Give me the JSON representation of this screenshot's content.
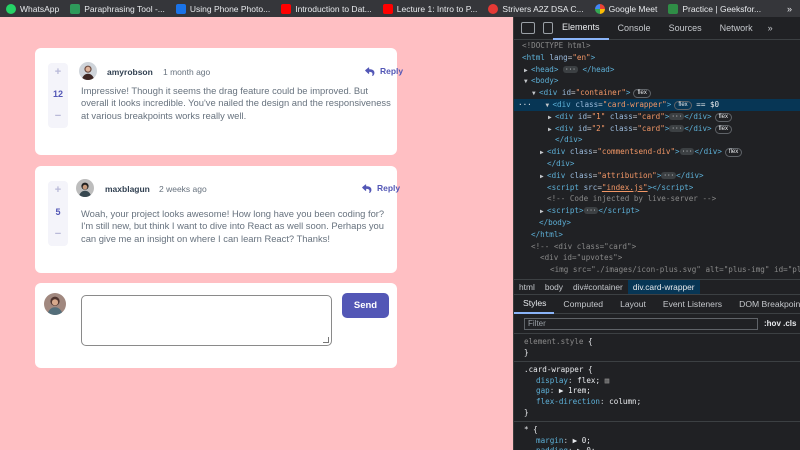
{
  "bookmarks": [
    {
      "label": "WhatsApp",
      "color": "#25d366",
      "icon": "whatsapp-icon"
    },
    {
      "label": "Paraphrasing Tool -...",
      "color": "#2e9a5a",
      "icon": "quillbot-icon"
    },
    {
      "label": "Using Phone Photo...",
      "color": "#1a73e8",
      "icon": "docs-icon"
    },
    {
      "label": "Introduction to Dat...",
      "color": "#ff0000",
      "icon": "youtube-icon"
    },
    {
      "label": "Lecture 1: Intro to P...",
      "color": "#ff0000",
      "icon": "youtube-icon"
    },
    {
      "label": "Strivers A2Z DSA C...",
      "color": "#e53935",
      "icon": "striver-icon"
    },
    {
      "label": "Google Meet",
      "color": "#00897b",
      "icon": "google-icon"
    },
    {
      "label": "Practice | Geeksfor...",
      "color": "#2f8d46",
      "icon": "gfg-icon"
    }
  ],
  "bookmarks_more": "»",
  "comments": [
    {
      "score": "12",
      "upvote": "+",
      "downvote": "−",
      "username": "amyrobson",
      "timestamp": "1 month ago",
      "reply": "Reply",
      "content": "Impressive! Though it seems the drag feature could be improved. But overall it looks incredible. You've nailed the design and the responsiveness at various breakpoints works really well."
    },
    {
      "score": "5",
      "upvote": "+",
      "downvote": "−",
      "username": "maxblagun",
      "timestamp": "2 weeks ago",
      "reply": "Reply",
      "content": "Woah, your project looks awesome! How long have you been coding for? I'm still new, but think I want to dive into React as well soon. Perhaps you can give me an insight on where I can learn React? Thanks!"
    }
  ],
  "composer": {
    "placeholder": "",
    "send_label": "Send"
  },
  "devtools": {
    "tabs": [
      "Elements",
      "Console",
      "Sources",
      "Network"
    ],
    "active_tab": "Elements",
    "more": "»",
    "breadcrumbs": [
      "html",
      "body",
      "div#container",
      "div.card-wrapper"
    ],
    "sub_tabs": [
      "Styles",
      "Computed",
      "Layout",
      "Event Listeners",
      "DOM Breakpoints"
    ],
    "filter_placeholder": "Filter",
    "filter_options": ":hov .cls",
    "colors": {
      "accent": "#5357b6",
      "page_bg": "#ffbfc3",
      "selection": "#073655"
    }
  }
}
